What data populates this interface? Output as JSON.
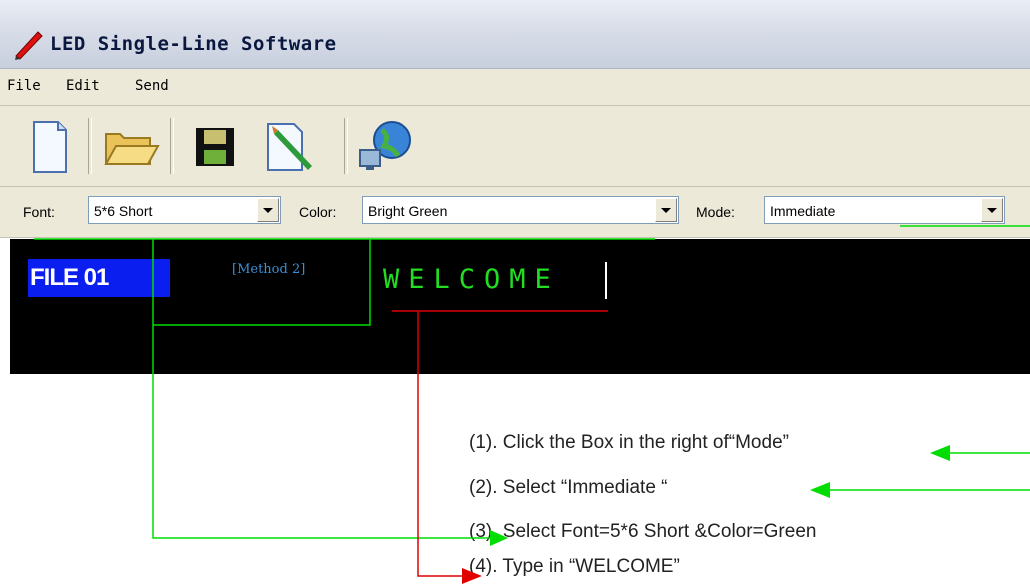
{
  "window": {
    "title": "LED Single-Line Software"
  },
  "menu": {
    "items": [
      "File",
      "Edit",
      "Send"
    ]
  },
  "toolbar": {
    "icons": [
      "new-file-icon",
      "open-folder-icon",
      "save-icon",
      "edit-brush-icon",
      "network-send-icon"
    ]
  },
  "options": {
    "font_label": "Font:",
    "font_value": "5*6 Short",
    "color_label": "Color:",
    "color_value": "Bright Green",
    "mode_label": "Mode:",
    "mode_value": "Immediate"
  },
  "display": {
    "file_label": "FILE 01",
    "method_label": "[Method 2]",
    "message": "WELCOME",
    "message_color": "#22dd22",
    "badge_color": "#0b1ef0"
  },
  "instructions": [
    "(1). Click the Box in the right of“Mode”",
    "(2). Select “Immediate “",
    "(3). Select Font=5*6 Short &Color=Green",
    "(4). Type in “WELCOME”"
  ],
  "annotation_colors": {
    "green": "#00dd00",
    "red": "#e00000"
  }
}
